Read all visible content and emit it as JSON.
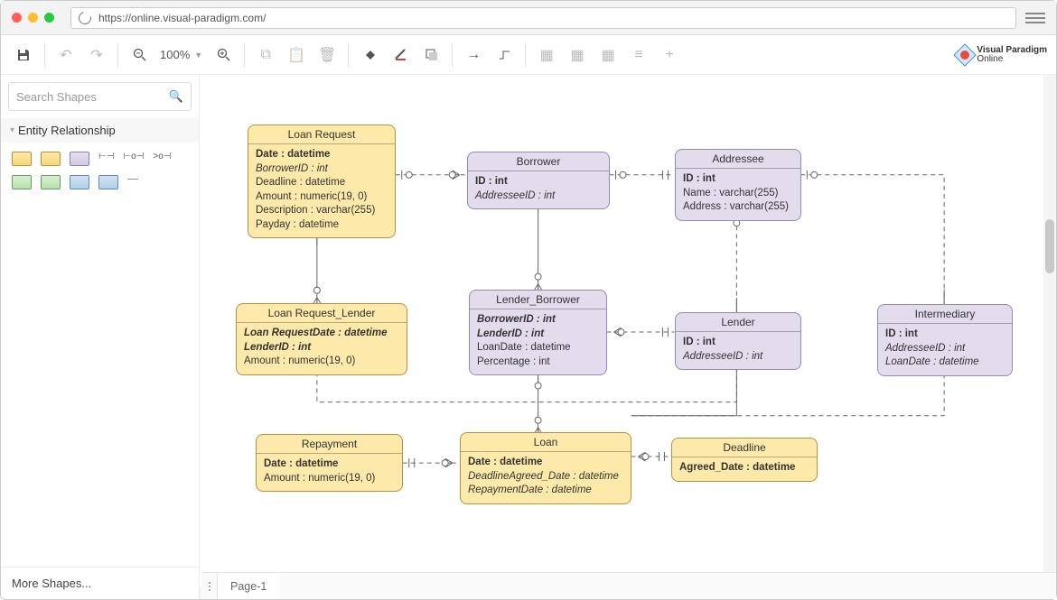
{
  "url": "https://online.visual-paradigm.com/",
  "zoom": "100%",
  "searchPlaceholder": "Search Shapes",
  "category": "Entity Relationship",
  "moreShapes": "More Shapes...",
  "logo": {
    "l1": "Visual Paradigm",
    "l2": "Online"
  },
  "page": "Page-1",
  "entities": {
    "loanRequest": {
      "title": "Loan Request",
      "rows": [
        {
          "t": "Date : datetime",
          "b": true
        },
        {
          "t": "BorrowerID : int",
          "i": true
        },
        {
          "t": "Deadline : datetime"
        },
        {
          "t": "Amount : numeric(19, 0)"
        },
        {
          "t": "Description : varchar(255)"
        },
        {
          "t": "Payday : datetime"
        }
      ]
    },
    "borrower": {
      "title": "Borrower",
      "rows": [
        {
          "t": "ID : int",
          "b": true
        },
        {
          "t": "AddresseeID : int",
          "i": true
        }
      ]
    },
    "addressee": {
      "title": "Addressee",
      "rows": [
        {
          "t": "ID : int",
          "b": true
        },
        {
          "t": "Name : varchar(255)"
        },
        {
          "t": "Address : varchar(255)"
        }
      ]
    },
    "lrl": {
      "title": "Loan Request_Lender",
      "rows": [
        {
          "t": "Loan RequestDate : datetime",
          "b": true,
          "i": true
        },
        {
          "t": "LenderID : int",
          "b": true,
          "i": true
        },
        {
          "t": "Amount : numeric(19, 0)"
        }
      ]
    },
    "lb": {
      "title": "Lender_Borrower",
      "rows": [
        {
          "t": "BorrowerID : int",
          "b": true,
          "i": true
        },
        {
          "t": "LenderID : int",
          "b": true,
          "i": true
        },
        {
          "t": "LoanDate : datetime"
        },
        {
          "t": "Percentage : int"
        }
      ]
    },
    "lender": {
      "title": "Lender",
      "rows": [
        {
          "t": "ID : int",
          "b": true
        },
        {
          "t": "AddresseeID : int",
          "i": true
        }
      ]
    },
    "intermediary": {
      "title": "Intermediary",
      "rows": [
        {
          "t": "ID : int",
          "b": true
        },
        {
          "t": "AddresseeID : int",
          "i": true
        },
        {
          "t": "LoanDate : datetime",
          "i": true
        }
      ]
    },
    "repayment": {
      "title": "Repayment",
      "rows": [
        {
          "t": "Date : datetime",
          "b": true
        },
        {
          "t": "Amount : numeric(19, 0)"
        }
      ]
    },
    "loan": {
      "title": "Loan",
      "rows": [
        {
          "t": "Date : datetime",
          "b": true
        },
        {
          "t": "DeadlineAgreed_Date : datetime",
          "i": true
        },
        {
          "t": "RepaymentDate : datetime",
          "i": true
        }
      ]
    },
    "deadline": {
      "title": "Deadline",
      "rows": [
        {
          "t": "Agreed_Date : datetime",
          "b": true
        }
      ]
    }
  }
}
